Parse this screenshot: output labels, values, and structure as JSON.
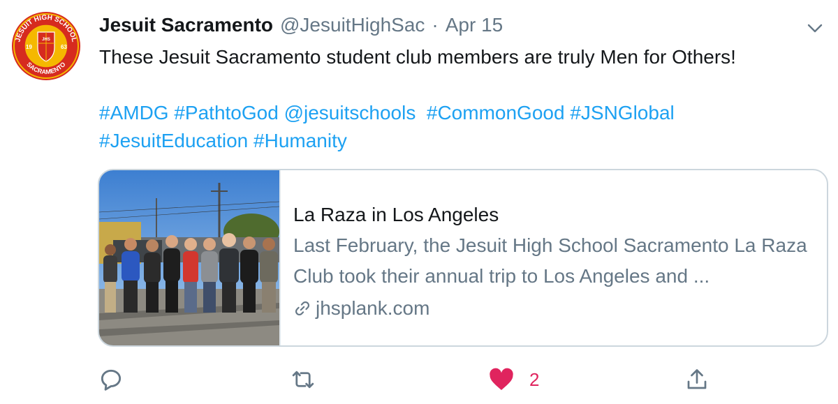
{
  "tweet": {
    "author_name": "Jesuit Sacramento",
    "handle": "@JesuitHighSac",
    "separator": "·",
    "date": "Apr 15",
    "text": "These Jesuit Sacramento student club members are truly Men for Others!",
    "tags_line1": [
      "#AMDG",
      "#PathtoGod",
      "@jesuitschools",
      "#CommonGood",
      "#JSNGlobal"
    ],
    "tags_line2": [
      "#JesuitEducation",
      "#Humanity"
    ]
  },
  "avatar_logo": {
    "ring_top": "JESUIT HIGH SCHOOL",
    "ring_bottom": "SACRAMENTO",
    "year_left": "19",
    "year_right": "63",
    "shield_text": "JHS"
  },
  "card": {
    "title": "La Raza in Los Angeles",
    "description": "Last February, the Jesuit High School Sacramento La Raza Club took their annual trip to Los Angeles and ...",
    "domain": "jhsplank.com"
  },
  "actions": {
    "reply_icon": "reply-icon",
    "retweet_icon": "retweet-icon",
    "like_icon": "heart-icon",
    "like_count": "2",
    "share_icon": "share-icon"
  },
  "colors": {
    "link": "#1da1f2",
    "muted": "#657786",
    "like": "#e0245e",
    "logo_red": "#d62b1f",
    "logo_gold": "#f5b800"
  }
}
